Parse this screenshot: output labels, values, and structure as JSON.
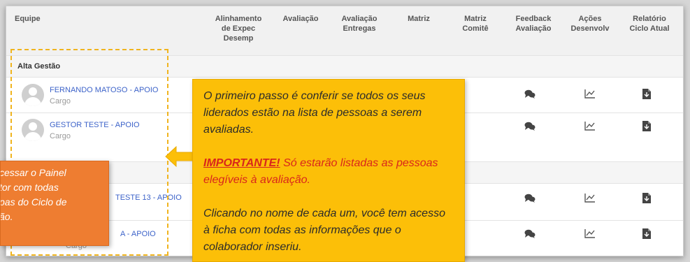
{
  "table": {
    "headers": [
      {
        "id": "equipe",
        "lines": [
          "Equipe"
        ]
      },
      {
        "id": "alinhamento",
        "lines": [
          "Alinhamento",
          "de Expec",
          "Desemp"
        ]
      },
      {
        "id": "avaliacao",
        "lines": [
          "Avaliação"
        ]
      },
      {
        "id": "avaliacao-entregas",
        "lines": [
          "Avaliação",
          "Entregas"
        ]
      },
      {
        "id": "matriz",
        "lines": [
          "Matriz"
        ]
      },
      {
        "id": "matriz-comite",
        "lines": [
          "Matriz",
          "Comitê"
        ]
      },
      {
        "id": "feedback",
        "lines": [
          "Feedback",
          "Avaliação"
        ]
      },
      {
        "id": "acoes",
        "lines": [
          "Ações",
          "Desenvolv"
        ]
      },
      {
        "id": "relatorio",
        "lines": [
          "Relatório",
          "Ciclo Atual"
        ]
      }
    ],
    "group1": "Alta Gestão",
    "rows": [
      {
        "name": "FERNANDO MATOSO - APOIO",
        "role": "Cargo"
      },
      {
        "name": "GESTOR TESTE - APOIO",
        "role": "Cargo"
      },
      {
        "name": "TESTE 13 - APOIO",
        "role": ""
      },
      {
        "name": "A - APOIO",
        "role": "Cargo"
      }
    ]
  },
  "callout": {
    "p1": "O primeiro passo é conferir se todos os seus liderados estão na lista de pessoas a serem avaliadas.",
    "imp_title": "IMPORTANTE!",
    "imp_text": " Só estarão listadas as pessoas elegíveis à avaliação.",
    "p3": "Clicando no nome de cada um, você tem acesso à ficha com todas as informações que o colaborador inseriu."
  },
  "side_note": {
    "lines": [
      "cessar  o Painel",
      "tor com todas",
      "pas do Ciclo de",
      "ão."
    ]
  },
  "icons": {
    "feedback": "chat-bubbles-icon",
    "acoes": "chart-line-icon",
    "relatorio": "file-download-icon",
    "arrow": "arrow-left-icon"
  },
  "colors": {
    "accent_yellow": "#fcbf08",
    "accent_orange": "#ee7d31",
    "link": "#3d63c9",
    "important": "#d9261c"
  }
}
